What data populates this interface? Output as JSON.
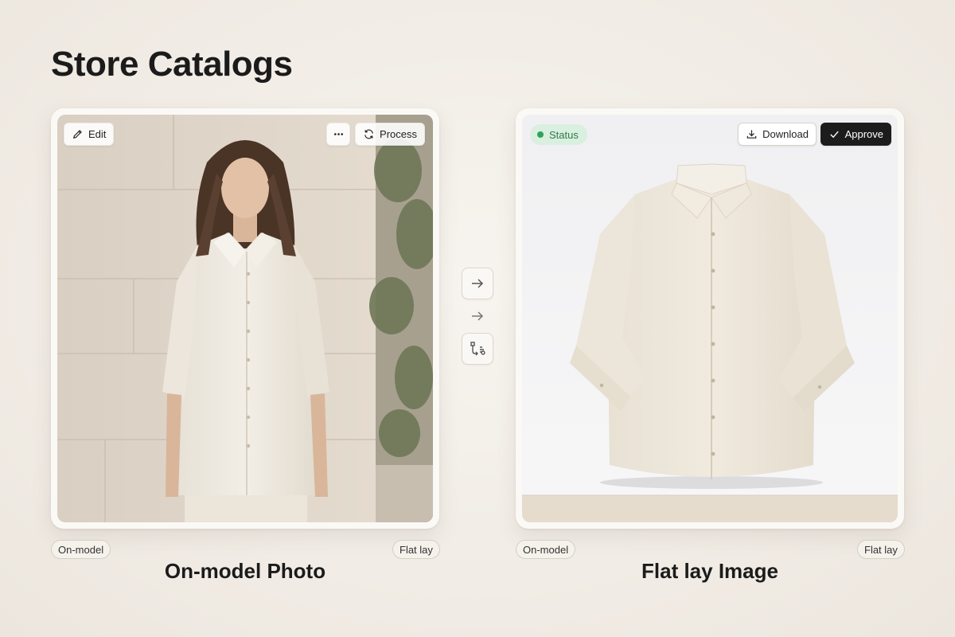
{
  "page": {
    "title": "Store Catalogs"
  },
  "source_card": {
    "edit_label": "Edit",
    "process_label": "Process",
    "tag_left": "On-model",
    "tag_right": "Flat lay",
    "caption": "On-model Photo"
  },
  "result_card": {
    "status_label": "Status",
    "download_label": "Download",
    "approve_label": "Approve",
    "tag_left": "On-model",
    "tag_right": "Flat lay",
    "caption": "Flat lay Image"
  },
  "icons": {
    "edit": "pencil-icon",
    "more": "ellipsis-icon",
    "process": "refresh-icon",
    "download": "download-icon",
    "approve": "check-icon",
    "convert": "arrow-right-icon",
    "transform": "transform-icon"
  },
  "colors": {
    "accent_dark": "#1c1c1c",
    "status_bg": "#d9efe0",
    "status_dot": "#2fa35b",
    "status_text": "#2f7a4a",
    "page_bg": "#f1ece5"
  }
}
